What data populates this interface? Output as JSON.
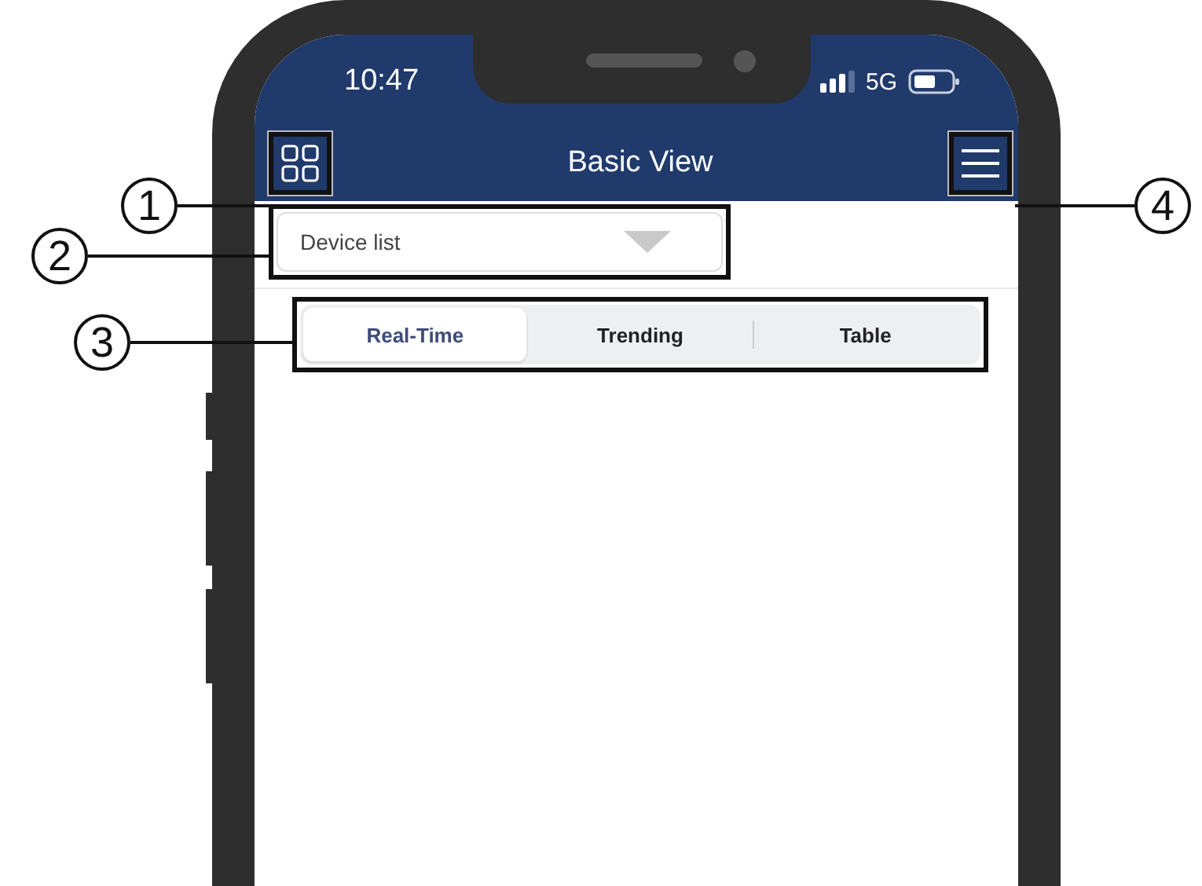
{
  "status_bar": {
    "time": "10:47",
    "network": "5G"
  },
  "header": {
    "title": "Basic View"
  },
  "device_dropdown": {
    "value": "Device list"
  },
  "view_tabs": [
    {
      "label": "Real-Time",
      "selected": true
    },
    {
      "label": "Trending",
      "selected": false
    },
    {
      "label": "Table",
      "selected": false
    }
  ],
  "callouts": [
    "1",
    "2",
    "3",
    "4"
  ]
}
